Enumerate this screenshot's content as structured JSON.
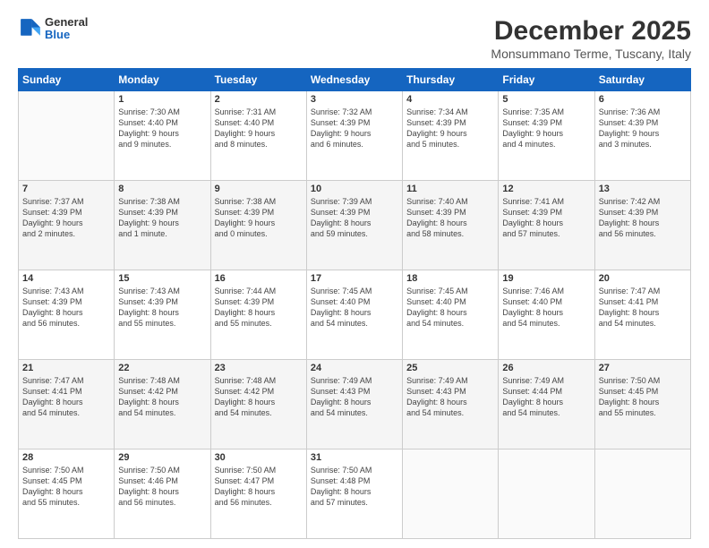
{
  "header": {
    "logo": {
      "general": "General",
      "blue": "Blue"
    },
    "title": "December 2025",
    "location": "Monsummano Terme, Tuscany, Italy"
  },
  "calendar": {
    "days": [
      "Sunday",
      "Monday",
      "Tuesday",
      "Wednesday",
      "Thursday",
      "Friday",
      "Saturday"
    ],
    "weeks": [
      [
        {
          "day": "",
          "content": ""
        },
        {
          "day": "1",
          "content": "Sunrise: 7:30 AM\nSunset: 4:40 PM\nDaylight: 9 hours\nand 9 minutes."
        },
        {
          "day": "2",
          "content": "Sunrise: 7:31 AM\nSunset: 4:40 PM\nDaylight: 9 hours\nand 8 minutes."
        },
        {
          "day": "3",
          "content": "Sunrise: 7:32 AM\nSunset: 4:39 PM\nDaylight: 9 hours\nand 6 minutes."
        },
        {
          "day": "4",
          "content": "Sunrise: 7:34 AM\nSunset: 4:39 PM\nDaylight: 9 hours\nand 5 minutes."
        },
        {
          "day": "5",
          "content": "Sunrise: 7:35 AM\nSunset: 4:39 PM\nDaylight: 9 hours\nand 4 minutes."
        },
        {
          "day": "6",
          "content": "Sunrise: 7:36 AM\nSunset: 4:39 PM\nDaylight: 9 hours\nand 3 minutes."
        }
      ],
      [
        {
          "day": "7",
          "content": "Sunrise: 7:37 AM\nSunset: 4:39 PM\nDaylight: 9 hours\nand 2 minutes."
        },
        {
          "day": "8",
          "content": "Sunrise: 7:38 AM\nSunset: 4:39 PM\nDaylight: 9 hours\nand 1 minute."
        },
        {
          "day": "9",
          "content": "Sunrise: 7:38 AM\nSunset: 4:39 PM\nDaylight: 9 hours\nand 0 minutes."
        },
        {
          "day": "10",
          "content": "Sunrise: 7:39 AM\nSunset: 4:39 PM\nDaylight: 8 hours\nand 59 minutes."
        },
        {
          "day": "11",
          "content": "Sunrise: 7:40 AM\nSunset: 4:39 PM\nDaylight: 8 hours\nand 58 minutes."
        },
        {
          "day": "12",
          "content": "Sunrise: 7:41 AM\nSunset: 4:39 PM\nDaylight: 8 hours\nand 57 minutes."
        },
        {
          "day": "13",
          "content": "Sunrise: 7:42 AM\nSunset: 4:39 PM\nDaylight: 8 hours\nand 56 minutes."
        }
      ],
      [
        {
          "day": "14",
          "content": "Sunrise: 7:43 AM\nSunset: 4:39 PM\nDaylight: 8 hours\nand 56 minutes."
        },
        {
          "day": "15",
          "content": "Sunrise: 7:43 AM\nSunset: 4:39 PM\nDaylight: 8 hours\nand 55 minutes."
        },
        {
          "day": "16",
          "content": "Sunrise: 7:44 AM\nSunset: 4:39 PM\nDaylight: 8 hours\nand 55 minutes."
        },
        {
          "day": "17",
          "content": "Sunrise: 7:45 AM\nSunset: 4:40 PM\nDaylight: 8 hours\nand 54 minutes."
        },
        {
          "day": "18",
          "content": "Sunrise: 7:45 AM\nSunset: 4:40 PM\nDaylight: 8 hours\nand 54 minutes."
        },
        {
          "day": "19",
          "content": "Sunrise: 7:46 AM\nSunset: 4:40 PM\nDaylight: 8 hours\nand 54 minutes."
        },
        {
          "day": "20",
          "content": "Sunrise: 7:47 AM\nSunset: 4:41 PM\nDaylight: 8 hours\nand 54 minutes."
        }
      ],
      [
        {
          "day": "21",
          "content": "Sunrise: 7:47 AM\nSunset: 4:41 PM\nDaylight: 8 hours\nand 54 minutes."
        },
        {
          "day": "22",
          "content": "Sunrise: 7:48 AM\nSunset: 4:42 PM\nDaylight: 8 hours\nand 54 minutes."
        },
        {
          "day": "23",
          "content": "Sunrise: 7:48 AM\nSunset: 4:42 PM\nDaylight: 8 hours\nand 54 minutes."
        },
        {
          "day": "24",
          "content": "Sunrise: 7:49 AM\nSunset: 4:43 PM\nDaylight: 8 hours\nand 54 minutes."
        },
        {
          "day": "25",
          "content": "Sunrise: 7:49 AM\nSunset: 4:43 PM\nDaylight: 8 hours\nand 54 minutes."
        },
        {
          "day": "26",
          "content": "Sunrise: 7:49 AM\nSunset: 4:44 PM\nDaylight: 8 hours\nand 54 minutes."
        },
        {
          "day": "27",
          "content": "Sunrise: 7:50 AM\nSunset: 4:45 PM\nDaylight: 8 hours\nand 55 minutes."
        }
      ],
      [
        {
          "day": "28",
          "content": "Sunrise: 7:50 AM\nSunset: 4:45 PM\nDaylight: 8 hours\nand 55 minutes."
        },
        {
          "day": "29",
          "content": "Sunrise: 7:50 AM\nSunset: 4:46 PM\nDaylight: 8 hours\nand 56 minutes."
        },
        {
          "day": "30",
          "content": "Sunrise: 7:50 AM\nSunset: 4:47 PM\nDaylight: 8 hours\nand 56 minutes."
        },
        {
          "day": "31",
          "content": "Sunrise: 7:50 AM\nSunset: 4:48 PM\nDaylight: 8 hours\nand 57 minutes."
        },
        {
          "day": "",
          "content": ""
        },
        {
          "day": "",
          "content": ""
        },
        {
          "day": "",
          "content": ""
        }
      ]
    ]
  }
}
